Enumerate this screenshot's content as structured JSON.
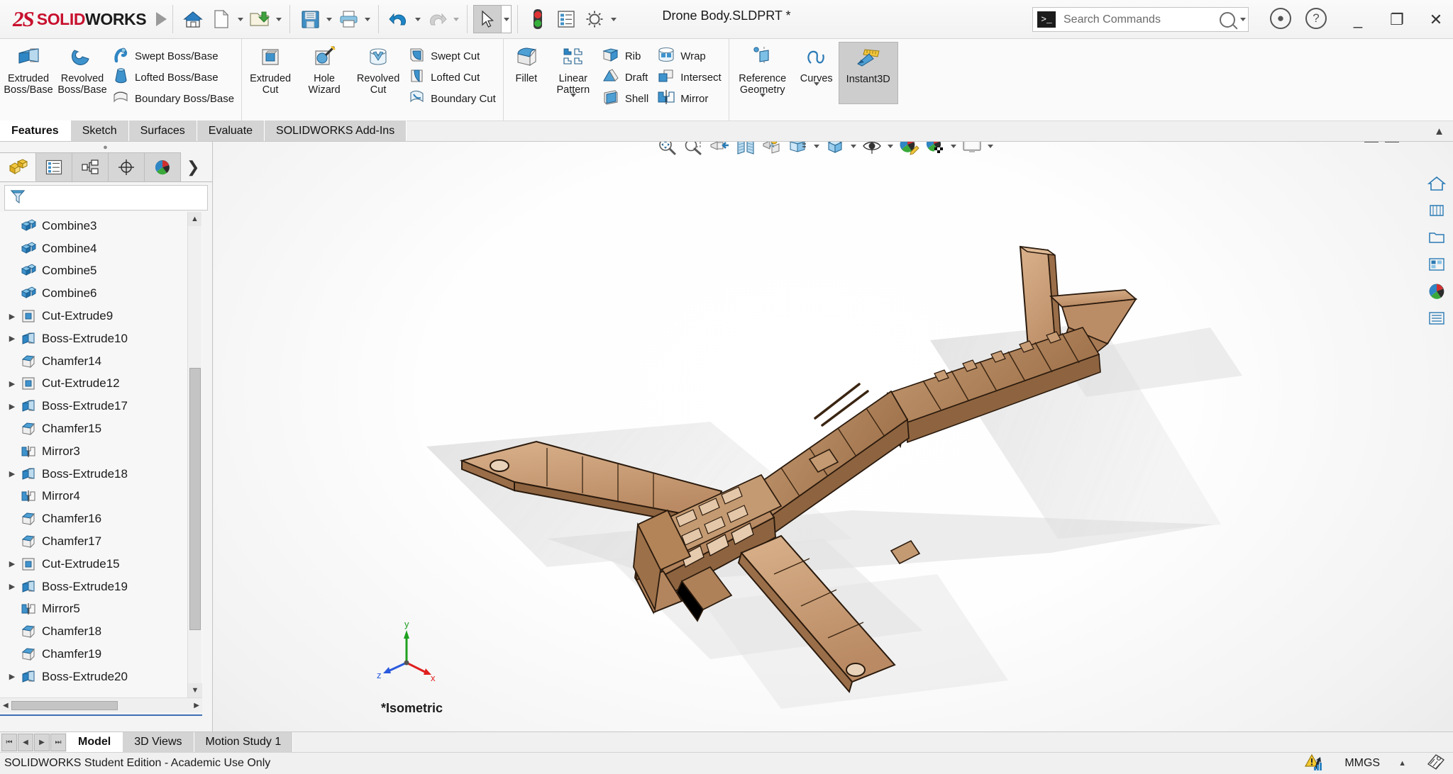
{
  "app": {
    "brand_ds": "2S",
    "brand_solid": "SOLID",
    "brand_works": "WORKS",
    "document_title": "Drone Body.SLDPRT *"
  },
  "titlebar": {
    "icons": [
      {
        "name": "home-icon",
        "label": "Home"
      },
      {
        "name": "new-document-icon",
        "label": "New"
      },
      {
        "name": "open-folder-icon",
        "label": "Open"
      },
      {
        "name": "save-icon",
        "label": "Save"
      },
      {
        "name": "print-icon",
        "label": "Print"
      },
      {
        "name": "undo-icon",
        "label": "Undo"
      },
      {
        "name": "redo-icon",
        "label": "Redo"
      },
      {
        "name": "select-cursor-icon",
        "label": "Select"
      },
      {
        "name": "rebuild-traffic-light-icon",
        "label": "Rebuild"
      },
      {
        "name": "file-properties-icon",
        "label": "File Properties"
      },
      {
        "name": "options-gear-icon",
        "label": "Options"
      }
    ],
    "account_icon": "user-account-icon",
    "help_icon": "help-question-icon",
    "minimize_icon": "minimize-icon",
    "restore_icon": "restore-window-icon",
    "close_icon": "close-window-icon"
  },
  "search": {
    "placeholder": "Search Commands",
    "value": ""
  },
  "ribbon": {
    "groups": [
      {
        "name": "features-boss",
        "big": [
          {
            "label": "Extruded\nBoss/Base",
            "line1": "Extruded",
            "line2": "Boss/Base",
            "icon": "extruded-boss-icon"
          },
          {
            "label": "Revolved\nBoss/Base",
            "line1": "Revolved",
            "line2": "Boss/Base",
            "icon": "revolved-boss-icon"
          }
        ],
        "small": [
          {
            "label": "Swept Boss/Base",
            "icon": "swept-boss-icon"
          },
          {
            "label": "Lofted Boss/Base",
            "icon": "lofted-boss-icon"
          },
          {
            "label": "Boundary Boss/Base",
            "icon": "boundary-boss-icon"
          }
        ]
      },
      {
        "name": "features-cut",
        "big": [
          {
            "line1": "Extruded",
            "line2": "Cut",
            "icon": "extruded-cut-icon"
          },
          {
            "line1": "Hole",
            "line2": "Wizard",
            "icon": "hole-wizard-icon"
          },
          {
            "line1": "Revolved",
            "line2": "Cut",
            "icon": "revolved-cut-icon"
          }
        ],
        "small": [
          {
            "label": "Swept Cut",
            "icon": "swept-cut-icon"
          },
          {
            "label": "Lofted Cut",
            "icon": "lofted-cut-icon"
          },
          {
            "label": "Boundary Cut",
            "icon": "boundary-cut-icon"
          }
        ]
      },
      {
        "name": "features-modify",
        "big": [
          {
            "line1": "Fillet",
            "line2": "",
            "icon": "fillet-icon"
          },
          {
            "line1": "Linear",
            "line2": "Pattern",
            "icon": "linear-pattern-icon"
          }
        ],
        "small": [
          {
            "label": "Rib",
            "icon": "rib-icon"
          },
          {
            "label": "Draft",
            "icon": "draft-icon"
          },
          {
            "label": "Shell",
            "icon": "shell-icon"
          }
        ],
        "small2": [
          {
            "label": "Wrap",
            "icon": "wrap-icon"
          },
          {
            "label": "Intersect",
            "icon": "intersect-icon"
          },
          {
            "label": "Mirror",
            "icon": "mirror-icon"
          }
        ]
      },
      {
        "name": "features-reference",
        "big": [
          {
            "line1": "Reference",
            "line2": "Geometry",
            "icon": "reference-geometry-icon"
          },
          {
            "line1": "Curves",
            "line2": "",
            "icon": "curves-icon"
          },
          {
            "line1": "Instant3D",
            "line2": "",
            "icon": "instant3d-icon",
            "selected": true
          }
        ]
      }
    ]
  },
  "command_tabs": [
    {
      "label": "Features",
      "active": true
    },
    {
      "label": "Sketch",
      "active": false
    },
    {
      "label": "Surfaces",
      "active": false
    },
    {
      "label": "Evaluate",
      "active": false
    },
    {
      "label": "SOLIDWORKS Add-Ins",
      "active": false
    }
  ],
  "manager_tabs": [
    {
      "name": "feature-manager-tab",
      "icon": "yellow-blocks-icon",
      "active": true
    },
    {
      "name": "property-manager-tab",
      "icon": "property-list-icon",
      "active": false
    },
    {
      "name": "configuration-manager-tab",
      "icon": "configuration-tree-icon",
      "active": false
    },
    {
      "name": "dimxpert-manager-tab",
      "icon": "crosshair-icon",
      "active": false
    },
    {
      "name": "display-manager-tab",
      "icon": "appearance-sphere-icon",
      "active": false
    }
  ],
  "feature_tree": {
    "filter_icon": "filter-funnel-icon",
    "nodes": [
      {
        "label": "Combine3",
        "icon": "combine-icon",
        "expandable": false
      },
      {
        "label": "Combine4",
        "icon": "combine-icon",
        "expandable": false
      },
      {
        "label": "Combine5",
        "icon": "combine-icon",
        "expandable": false
      },
      {
        "label": "Combine6",
        "icon": "combine-icon",
        "expandable": false
      },
      {
        "label": "Cut-Extrude9",
        "icon": "cut-extrude-icon",
        "expandable": true
      },
      {
        "label": "Boss-Extrude10",
        "icon": "boss-extrude-icon",
        "expandable": true
      },
      {
        "label": "Chamfer14",
        "icon": "chamfer-icon",
        "expandable": false
      },
      {
        "label": "Cut-Extrude12",
        "icon": "cut-extrude-icon",
        "expandable": true
      },
      {
        "label": "Boss-Extrude17",
        "icon": "boss-extrude-icon",
        "expandable": true
      },
      {
        "label": "Chamfer15",
        "icon": "chamfer-icon",
        "expandable": false
      },
      {
        "label": "Mirror3",
        "icon": "mirror-feature-icon",
        "expandable": false
      },
      {
        "label": "Boss-Extrude18",
        "icon": "boss-extrude-icon",
        "expandable": true
      },
      {
        "label": "Mirror4",
        "icon": "mirror-feature-icon",
        "expandable": false
      },
      {
        "label": "Chamfer16",
        "icon": "chamfer-icon",
        "expandable": false
      },
      {
        "label": "Chamfer17",
        "icon": "chamfer-icon",
        "expandable": false
      },
      {
        "label": "Cut-Extrude15",
        "icon": "cut-extrude-icon",
        "expandable": true
      },
      {
        "label": "Boss-Extrude19",
        "icon": "boss-extrude-icon",
        "expandable": true
      },
      {
        "label": "Mirror5",
        "icon": "mirror-feature-icon",
        "expandable": false
      },
      {
        "label": "Chamfer18",
        "icon": "chamfer-icon",
        "expandable": false
      },
      {
        "label": "Chamfer19",
        "icon": "chamfer-icon",
        "expandable": false
      },
      {
        "label": "Boss-Extrude20",
        "icon": "boss-extrude-icon",
        "expandable": true
      }
    ]
  },
  "view_toolbar": [
    {
      "name": "zoom-to-fit-icon"
    },
    {
      "name": "zoom-to-area-icon"
    },
    {
      "name": "previous-view-icon"
    },
    {
      "name": "section-view-icon"
    },
    {
      "name": "view-orientation-icon"
    },
    {
      "name": "display-style-icon"
    },
    {
      "name": "hide-show-items-icon"
    },
    {
      "name": "edit-appearance-icon"
    },
    {
      "name": "apply-scene-icon"
    },
    {
      "name": "view-settings-icon"
    }
  ],
  "right_toolbar": [
    {
      "name": "view-home-icon"
    },
    {
      "name": "view-front-icon"
    },
    {
      "name": "view-folder-icon"
    },
    {
      "name": "view-layout-icon"
    },
    {
      "name": "view-appearance-icon"
    },
    {
      "name": "view-list-icon"
    }
  ],
  "graphics": {
    "view_label": "*Isometric",
    "triad": {
      "x": "x",
      "y": "y",
      "z": "z"
    },
    "model_color": "#b98a63"
  },
  "bottom_tabs": [
    {
      "label": "Model",
      "active": true
    },
    {
      "label": "3D Views",
      "active": false
    },
    {
      "label": "Motion Study 1",
      "active": false
    }
  ],
  "status_bar": {
    "message": "SOLIDWORKS Student Edition - Academic Use Only",
    "units": "MMGS",
    "warning_icon": "performance-warning-icon",
    "overlay_icon": "custom-tag-icon"
  },
  "colors": {
    "brand_red": "#c8102e",
    "accent_blue": "#3f6fb5",
    "icon_blue": "#2a7ab5",
    "model_tan": "#b98a63"
  }
}
